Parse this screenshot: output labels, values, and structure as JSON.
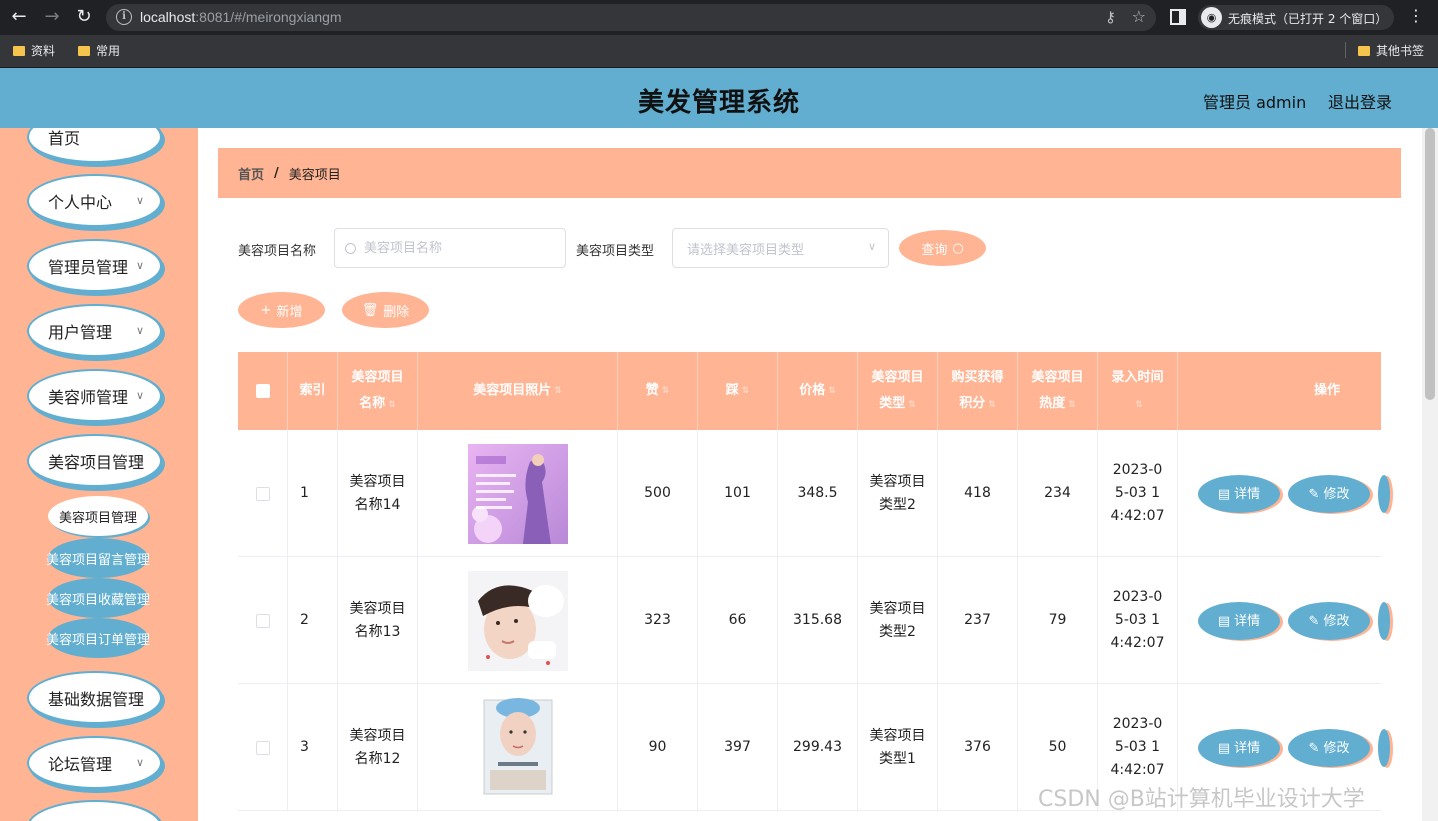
{
  "browser": {
    "url_host": "localhost",
    "url_rest": ":8081/#/meirongxiangm",
    "incognito_label": "无痕模式（已打开 2 个窗口）",
    "bookmarks": [
      "资料",
      "常用"
    ],
    "other_bookmarks": "其他书签"
  },
  "header": {
    "title": "美发管理系统",
    "admin": "管理员 admin",
    "logout": "退出登录"
  },
  "sidebar": {
    "items": [
      {
        "label": "首页"
      },
      {
        "label": "个人中心"
      },
      {
        "label": "管理员管理"
      },
      {
        "label": "用户管理"
      },
      {
        "label": "美容师管理"
      },
      {
        "label": "美容项目管理"
      },
      {
        "label": "基础数据管理"
      },
      {
        "label": "论坛管理"
      }
    ],
    "sub_items": [
      {
        "label": "美容项目管理"
      },
      {
        "label": "美容项目留言管理"
      },
      {
        "label": "美容项目收藏管理"
      },
      {
        "label": "美容项目订单管理"
      }
    ]
  },
  "breadcrumb": {
    "home": "首页",
    "separator": "/",
    "current": "美容项目"
  },
  "search": {
    "name_label": "美容项目名称",
    "name_placeholder": "美容项目名称",
    "type_label": "美容项目类型",
    "type_placeholder": "请选择美容项目类型",
    "query_label": "查询"
  },
  "actions": {
    "add_label": "新增",
    "delete_label": "删除"
  },
  "table": {
    "columns": [
      "索引",
      "美容项目名称",
      "美容项目照片",
      "赞",
      "踩",
      "价格",
      "美容项目类型",
      "购买获得积分",
      "美容项目热度",
      "录入时间",
      "操作"
    ],
    "detail_label": "详情",
    "edit_label": "修改",
    "rows": [
      {
        "index": "1",
        "name": "美容项目名称14",
        "likes": "500",
        "dislikes": "101",
        "price": "348.5",
        "type": "美容项目类型2",
        "points": "418",
        "heat": "234",
        "time": "2023-05-03 14:42:07"
      },
      {
        "index": "2",
        "name": "美容项目名称13",
        "likes": "323",
        "dislikes": "66",
        "price": "315.68",
        "type": "美容项目类型2",
        "points": "237",
        "heat": "79",
        "time": "2023-05-03 14:42:07"
      },
      {
        "index": "3",
        "name": "美容项目名称12",
        "likes": "90",
        "dislikes": "397",
        "price": "299.43",
        "type": "美容项目类型1",
        "points": "376",
        "heat": "50",
        "time": "2023-05-03 14:42:07"
      }
    ]
  },
  "watermark": "CSDN @B站计算机毕业设计大学",
  "colors": {
    "accent_blue": "#61aed1",
    "accent_salmon": "#ffb494"
  }
}
